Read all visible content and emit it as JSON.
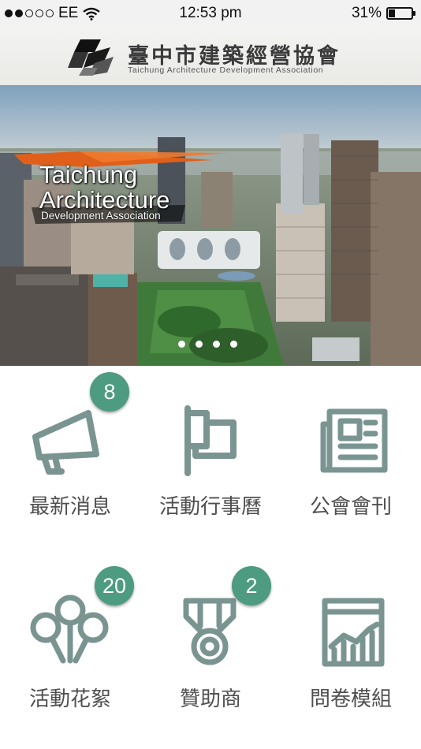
{
  "status_bar": {
    "carrier": "EE",
    "time": "12:53 pm",
    "battery": "31%"
  },
  "header": {
    "title": "臺中市建築經營協會",
    "subtitle": "Taichung Architecture Development Association"
  },
  "banner": {
    "title_line1": "Taichung",
    "title_line2": "Architecture",
    "subtitle": "Development Association",
    "slide_count": 4
  },
  "menu": [
    {
      "label": "最新消息",
      "badge": "8",
      "icon": "megaphone-icon"
    },
    {
      "label": "活動行事曆",
      "badge": null,
      "icon": "flag-icon"
    },
    {
      "label": "公會會刊",
      "badge": null,
      "icon": "newspaper-icon"
    },
    {
      "label": "活動花絮",
      "badge": "20",
      "icon": "balloons-icon"
    },
    {
      "label": "贊助商",
      "badge": "2",
      "icon": "medal-icon"
    },
    {
      "label": "問卷模組",
      "badge": null,
      "icon": "chart-icon"
    }
  ],
  "colors": {
    "accent": "#4d9b80",
    "icon": "#7a9591",
    "label": "#4f4f4f"
  }
}
